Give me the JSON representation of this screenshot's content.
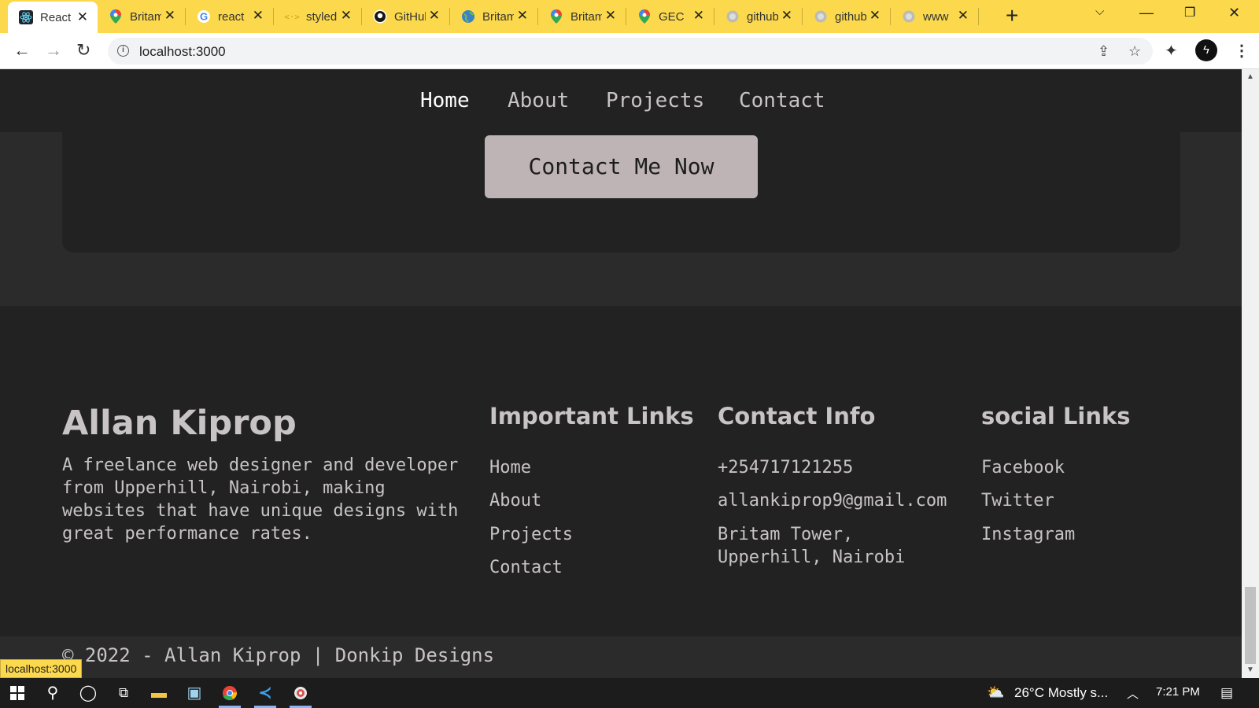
{
  "browser": {
    "tabs": [
      {
        "title": "React",
        "icon": "react-icon",
        "active": true
      },
      {
        "title": "Britam",
        "icon": "maps-pin-icon"
      },
      {
        "title": "react",
        "icon": "google-icon"
      },
      {
        "title": "styled",
        "icon": "code-icon"
      },
      {
        "title": "GitHub",
        "icon": "github-icon"
      },
      {
        "title": "Britam",
        "icon": "globe-icon"
      },
      {
        "title": "Britam",
        "icon": "maps-pin-icon"
      },
      {
        "title": "GEC",
        "icon": "maps-pin-icon"
      },
      {
        "title": "github",
        "icon": "globe-gray-icon"
      },
      {
        "title": "github",
        "icon": "globe-gray-icon"
      },
      {
        "title": "www",
        "icon": "globe-gray-icon"
      }
    ],
    "url": "localhost:3000",
    "status_url": "localhost:3000"
  },
  "nav": {
    "home": "Home",
    "about": "About",
    "projects": "Projects",
    "contact": "Contact"
  },
  "cta": {
    "button_label": "Contact Me Now"
  },
  "footer": {
    "name": "Allan Kiprop",
    "description": "A freelance web designer and developer from Upperhill, Nairobi, making websites that have unique designs with great performance rates.",
    "important_links": {
      "heading": "Important Links",
      "items": [
        "Home",
        "About",
        "Projects",
        "Contact"
      ]
    },
    "contact_info": {
      "heading": "Contact Info",
      "phone": "+254717121255",
      "email": "allankiprop9@gmail.com",
      "address": "Britam Tower, Upperhill, Nairobi"
    },
    "social_links": {
      "heading": "social Links",
      "items": [
        "Facebook",
        "Twitter",
        "Instagram"
      ]
    },
    "copyright": "© 2022 - Allan Kiprop | Donkip Designs"
  },
  "taskbar": {
    "weather": "26°C  Mostly s...",
    "time": "7:21 PM"
  },
  "colors": {
    "tab_bar": "#fbd84c",
    "page_bg": "#2b2b2b",
    "panel_bg": "#222222",
    "text": "#c8c3c4",
    "button_bg": "#bfb4b5"
  }
}
